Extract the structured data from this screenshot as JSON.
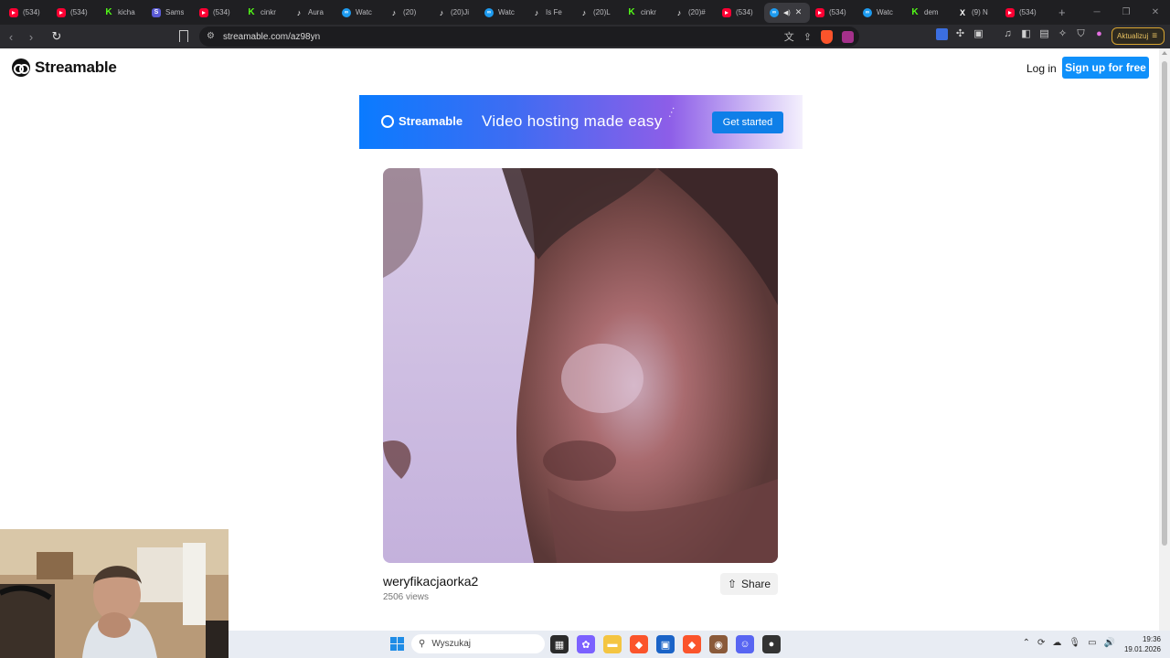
{
  "browser": {
    "tabs": [
      {
        "favicon": "youtube-icon",
        "kind": "yt",
        "label": "(534)"
      },
      {
        "favicon": "youtube-icon",
        "kind": "yt",
        "label": "(534)"
      },
      {
        "favicon": "kick-icon",
        "kind": "kick",
        "label": "kicha"
      },
      {
        "favicon": "app-icon",
        "kind": "sam",
        "label": "Sams"
      },
      {
        "favicon": "youtube-icon",
        "kind": "yt",
        "label": "(534)"
      },
      {
        "favicon": "kick-icon",
        "kind": "kick",
        "label": "cinkr"
      },
      {
        "favicon": "tiktok-icon",
        "kind": "tt",
        "label": "Aura"
      },
      {
        "favicon": "streamable-icon",
        "kind": "sm",
        "label": "Watc"
      },
      {
        "favicon": "tiktok-icon",
        "kind": "tt",
        "label": "(20)"
      },
      {
        "favicon": "tiktok-icon",
        "kind": "tt",
        "label": "(20)Ji"
      },
      {
        "favicon": "streamable-icon",
        "kind": "sm",
        "label": "Watc"
      },
      {
        "favicon": "tiktok-icon",
        "kind": "tt",
        "label": "Is Fe"
      },
      {
        "favicon": "tiktok-icon",
        "kind": "tt",
        "label": "(20)L"
      },
      {
        "favicon": "kick-icon",
        "kind": "kick",
        "label": "cinkr"
      },
      {
        "favicon": "tiktok-icon",
        "kind": "tt",
        "label": "(20)#"
      },
      {
        "favicon": "youtube-icon",
        "kind": "yt",
        "label": "(534)"
      },
      {
        "favicon": "streamable-icon",
        "kind": "sm",
        "label": "",
        "active": true
      },
      {
        "favicon": "youtube-icon",
        "kind": "yt",
        "label": "(534)"
      },
      {
        "favicon": "streamable-icon",
        "kind": "sm",
        "label": "Watc"
      },
      {
        "favicon": "kick-icon",
        "kind": "kick",
        "label": "dem"
      },
      {
        "favicon": "x-icon",
        "kind": "x",
        "label": "(9) N"
      },
      {
        "favicon": "youtube-icon",
        "kind": "yt",
        "label": "(534)"
      }
    ],
    "url": "streamable.com/az98yn",
    "update_label": "Aktualizuj"
  },
  "page": {
    "brand": "Streamable",
    "login_label": "Log in",
    "signup_label": "Sign up for free",
    "banner": {
      "brand": "Streamable",
      "tagline": "Video hosting made easy",
      "cta": "Get started"
    },
    "video": {
      "title": "weryfikacjaorka2",
      "views": "2506 views",
      "share_label": "Share"
    }
  },
  "taskbar": {
    "search_placeholder": "Wyszukaj",
    "time": "19:36",
    "date": "19.01.2026"
  },
  "colors": {
    "accent": "#0f90fa",
    "tab_bar": "#1f1f22",
    "taskbar": "#e8ecf3"
  }
}
